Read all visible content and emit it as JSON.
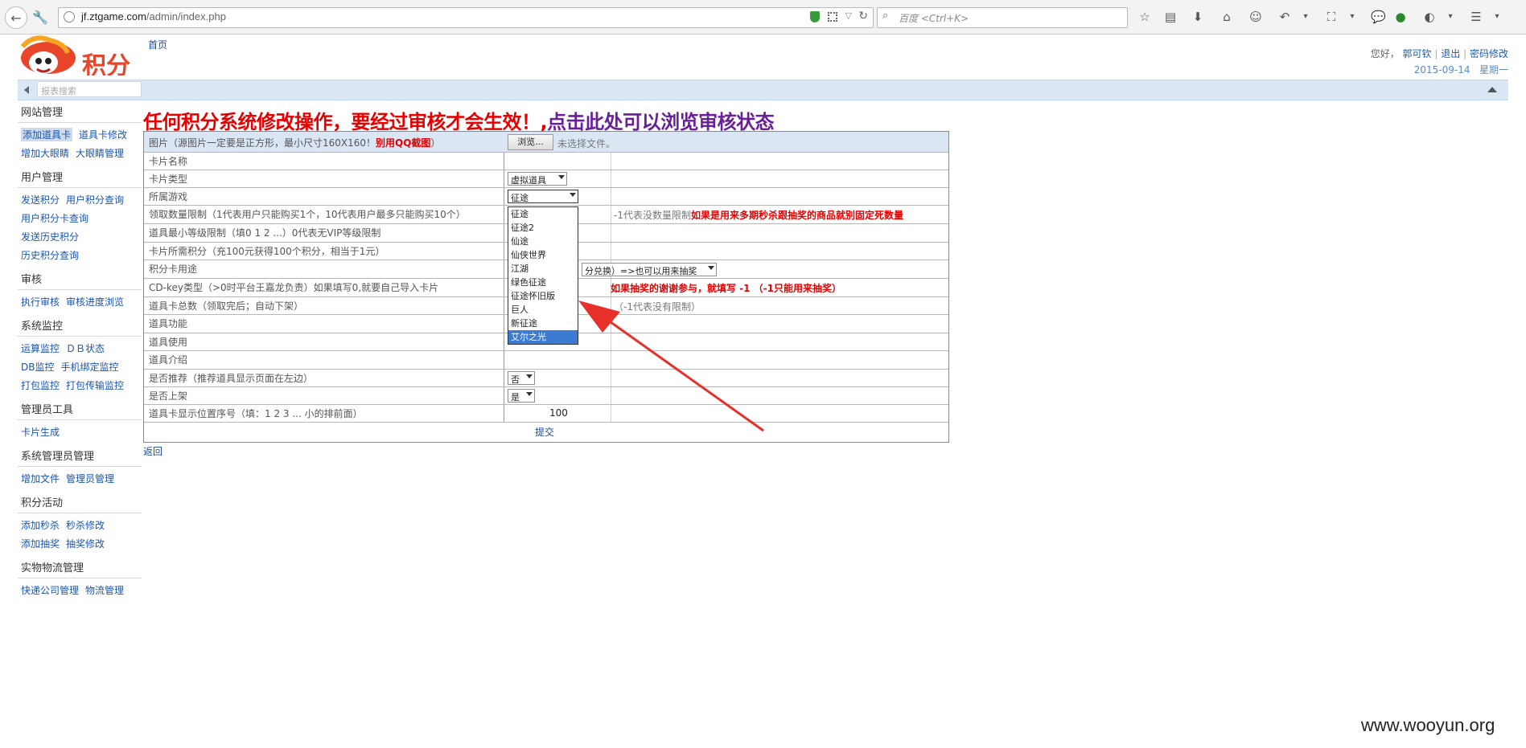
{
  "browser": {
    "url_host": "jf.ztgame.com",
    "url_path": "/admin/index.php",
    "search_placeholder": "百度 <Ctrl+K>"
  },
  "header": {
    "home_link": "首页",
    "greeting": "您好，",
    "user": "郭可钦",
    "logout": "退出",
    "change_password": "密码修改",
    "date": "2015-09-14",
    "weekday": "星期一",
    "sidebar_search_placeholder": "报表搜索"
  },
  "sidebar": {
    "sections": [
      {
        "title": "网站管理",
        "rows": [
          [
            "添加道具卡",
            "道具卡修改"
          ],
          [
            "增加大眼睛",
            "大眼睛管理"
          ]
        ]
      },
      {
        "title": "用户管理",
        "rows": [
          [
            "发送积分",
            "用户积分查询"
          ],
          [
            "用户积分卡查询"
          ],
          [
            "发送历史积分"
          ],
          [
            "历史积分查询"
          ]
        ]
      },
      {
        "title": "审核",
        "rows": [
          [
            "执行审核",
            "审核进度浏览"
          ]
        ]
      },
      {
        "title": "系统监控",
        "rows": [
          [
            "运算监控",
            "ＤＢ状态"
          ],
          [
            "DB监控",
            "手机绑定监控"
          ],
          [
            "打包监控",
            "打包传输监控"
          ]
        ]
      },
      {
        "title": "管理员工具",
        "rows": [
          [
            "卡片生成"
          ]
        ]
      },
      {
        "title": "系统管理员管理",
        "rows": [
          [
            "增加文件",
            "管理员管理"
          ]
        ]
      },
      {
        "title": "积分活动",
        "rows": [
          [
            "添加秒杀",
            "秒杀修改"
          ],
          [
            "添加抽奖",
            "抽奖修改"
          ]
        ]
      },
      {
        "title": "实物物流管理",
        "rows": [
          [
            "快递公司管理",
            "物流管理"
          ]
        ]
      }
    ]
  },
  "notice": {
    "red": "任何积分系统修改操作，要经过审核才会生效！,",
    "purple": "点击此处可以浏览审核状态"
  },
  "form": {
    "image_label": "图片（源图片一定要是正方形，最小尺寸160X160！",
    "image_label_red": "别用QQ截图",
    "image_label_end": "）",
    "browse": "浏览...",
    "no_file": "未选择文件。",
    "card_name": "卡片名称",
    "card_type": "卡片类型",
    "card_type_value": "虚拟道具",
    "game": "所属游戏",
    "game_value": "征途",
    "limit": "领取数量限制（1代表用户只能购买1个，10代表用户最多只能购买10个）",
    "limit_note": "-1代表没数量限制",
    "limit_note_red": "如果是用来多期秒杀跟抽奖的商品就别固定死数量",
    "min_level": "道具最小等级限制（填0 1 2 ...）0代表无VIP等级限制",
    "points": "卡片所需积分（充100元获得100个积分，相当于1元）",
    "usage": "积分卡用途",
    "usage_value": "分兑换）=>也可以用来抽奖",
    "cdkey": "CD-key类型（>0时平台王嘉龙负责）如果填写0,就要自己导入卡片",
    "cdkey_note_red": "如果抽奖的谢谢参与，就填写 -1 （-1只能用来抽奖）",
    "total": "道具卡总数（领取完后；自动下架）",
    "total_note": "（-1代表没有限制）",
    "function": "道具功能",
    "use": "道具使用",
    "intro": "道具介绍",
    "recommend": "是否推荐（推荐道具显示页面在左边）",
    "recommend_value": "否",
    "on_shelf": "是否上架",
    "on_shelf_value": "是",
    "order": "道具卡显示位置序号（填：1 2 3 ... 小的排前面）",
    "order_value": "100",
    "submit": "提交",
    "back": "返回"
  },
  "game_options": [
    "征途",
    "征途2",
    "仙途",
    "仙侠世界",
    "江湖",
    "绿色征途",
    "征途怀旧版",
    "巨人",
    "新征途",
    "艾尔之光"
  ],
  "watermark": "www.wooyun.org"
}
